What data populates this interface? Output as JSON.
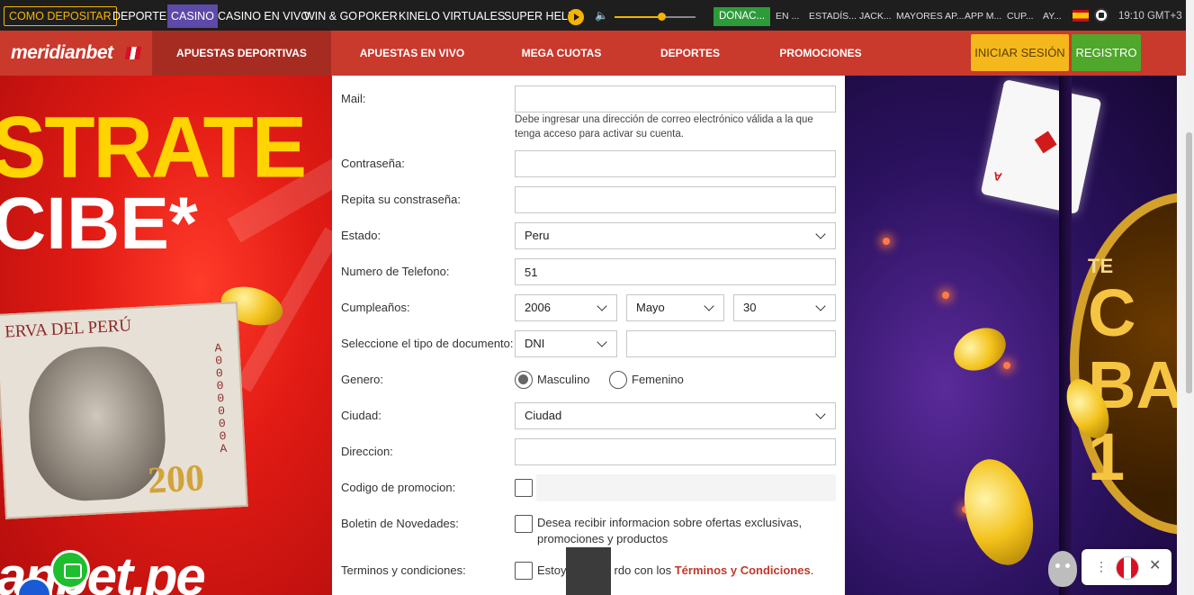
{
  "topbar": {
    "deposit_label": "COMO DEPOSITAR",
    "nav": [
      "DEPORTES",
      "CASINO",
      "CASINO EN VIVO",
      "WIN & GO",
      "POKER",
      "KINELO",
      "VIRTUALES",
      "SUPER HELI"
    ],
    "active_nav": "CASINO",
    "volume_level_percent": 58,
    "donate_label": "DONAC...",
    "small_links": [
      "EN ...",
      "ESTADÍS...",
      "JACK...",
      "MAYORES AP...",
      "APP M...",
      "CUP...",
      "AY..."
    ],
    "time": "19:10 GMT+3"
  },
  "header": {
    "logo": "meridianbet",
    "nav": [
      "APUESTAS DEPORTIVAS",
      "APUESTAS EN VIVO",
      "MEGA CUOTAS",
      "DEPORTES",
      "PROMOCIONES"
    ],
    "login_label": "INICIAR SESIÓN",
    "register_label": "REGISTRO"
  },
  "left_banner": {
    "line1": "STRATE",
    "line2": "CIBE*",
    "bill_header": "ERVA DEL PERÚ",
    "bill_value": "200",
    "bill_serial": "A0000000A",
    "url": "anbet.pe"
  },
  "form": {
    "mail": {
      "label": "Mail:",
      "value": "",
      "hint": "Debe ingresar una dirección de correo electrónico válida a la que tenga acceso para activar su cuenta."
    },
    "password": {
      "label": "Contraseña:",
      "value": ""
    },
    "password_repeat": {
      "label": "Repita su constraseña:",
      "value": ""
    },
    "state": {
      "label": "Estado:",
      "value": "Peru"
    },
    "phone": {
      "label": "Numero de Telefono:",
      "value": "51"
    },
    "birthday": {
      "label": "Cumpleaños:",
      "year": "2006",
      "month": "Mayo",
      "day": "30"
    },
    "document": {
      "label": "Seleccione el tipo de documento:",
      "type": "DNI",
      "number": ""
    },
    "gender": {
      "label": "Genero:",
      "options": [
        "Masculino",
        "Femenino"
      ],
      "selected": "Masculino"
    },
    "city": {
      "label": "Ciudad:",
      "value": "Ciudad"
    },
    "address": {
      "label": "Direccion:",
      "value": ""
    },
    "promo": {
      "label": "Codigo de promocion:"
    },
    "newsletter": {
      "label": "Boletin de Novedades:",
      "line1": "Desea recibir informacion sobre ofertas exclusivas,",
      "line2": "promociones y productos"
    },
    "terms": {
      "label": "Terminos y condiciones:",
      "prefix": "Estoy",
      "middle": "rdo con los",
      "link": "Términos y Condiciones",
      "suffix": "."
    }
  },
  "right_banner": {
    "wheel_text_top": "TE",
    "wheel_text_1": "C",
    "wheel_text_2": "BA",
    "wheel_text_3": "1",
    "card_rank": "A"
  }
}
